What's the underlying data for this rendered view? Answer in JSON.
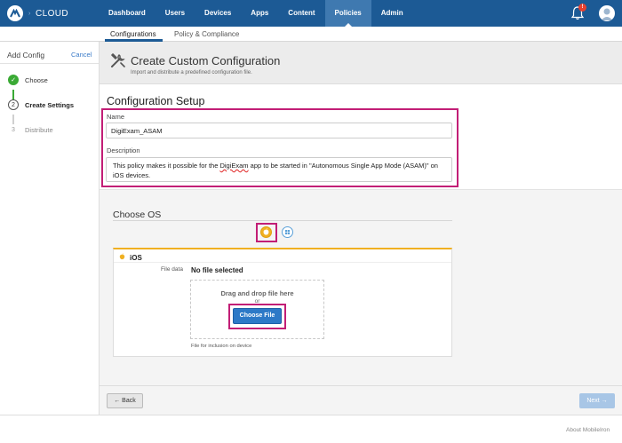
{
  "app": {
    "brand": "CLOUD"
  },
  "nav": {
    "items": [
      {
        "label": "Dashboard"
      },
      {
        "label": "Users"
      },
      {
        "label": "Devices"
      },
      {
        "label": "Apps"
      },
      {
        "label": "Content"
      },
      {
        "label": "Policies",
        "active": true
      },
      {
        "label": "Admin"
      }
    ],
    "notification_count": "!"
  },
  "subnav": {
    "items": [
      {
        "label": "Configurations",
        "active": true
      },
      {
        "label": "Policy & Compliance"
      }
    ]
  },
  "steps_panel": {
    "title": "Add Config",
    "cancel": "Cancel",
    "steps": [
      {
        "number": "✓",
        "label": "Choose",
        "state": "done"
      },
      {
        "number": "2",
        "label": "Create Settings",
        "state": "current"
      },
      {
        "number": "3",
        "label": "Distribute",
        "state": "pending"
      }
    ]
  },
  "header": {
    "title": "Create Custom Configuration",
    "subtitle": "Import and distribute a predefined configuration file."
  },
  "setup": {
    "title": "Configuration Setup",
    "name_label": "Name",
    "name_value": "DigiExam_ASAM",
    "description_label": "Description",
    "description_pre": "This policy makes it possible for the ",
    "description_word": "DigiExam",
    "description_post": " app to be started in \"Autonomous Single App Mode (ASAM)\" on iOS devices."
  },
  "os": {
    "title": "Choose OS",
    "options": [
      {
        "name": "apple-icon",
        "selected": true
      },
      {
        "name": "windows-icon",
        "selected": false
      }
    ]
  },
  "ios_card": {
    "heading": "iOS",
    "file_label": "File data",
    "file_status": "No file selected",
    "drop_text": "Drag and drop file here",
    "or_text": "or",
    "choose_button": "Choose File",
    "hint": "File for inclusion on device"
  },
  "footer": {
    "back": "← Back",
    "next": "Next →",
    "about": "About MobileIron"
  },
  "colors": {
    "nav_bg": "#1c5a95",
    "highlight": "#c21e76",
    "accent": "#2d79c7",
    "ios_accent": "#f0b021",
    "step_done": "#3aaa35"
  }
}
